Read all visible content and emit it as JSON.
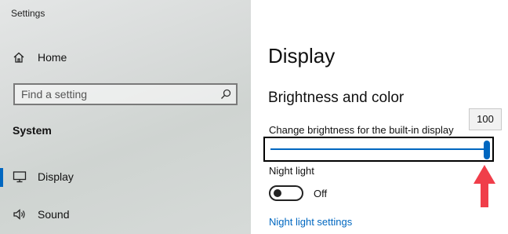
{
  "window": {
    "title": "Settings"
  },
  "sidebar": {
    "home_label": "Home",
    "search": {
      "placeholder": "Find a setting"
    },
    "section_label": "System",
    "items": [
      {
        "label": "Display",
        "icon": "monitor-icon",
        "active": true
      },
      {
        "label": "Sound",
        "icon": "speaker-icon",
        "active": false
      }
    ]
  },
  "main": {
    "title": "Display",
    "section_title": "Brightness and color",
    "brightness": {
      "label": "Change brightness for the built-in display",
      "value": 100,
      "tooltip": "100"
    },
    "night_light": {
      "label": "Night light",
      "state": "Off",
      "link": "Night light settings"
    }
  },
  "colors": {
    "accent": "#0067c0",
    "annotation_arrow": "#f03e4a"
  }
}
